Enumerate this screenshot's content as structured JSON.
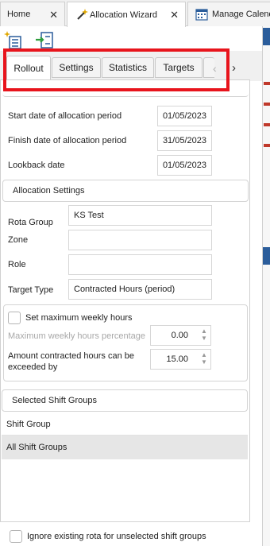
{
  "doc_tabs": {
    "home": "Home",
    "wizard": "Allocation Wizard",
    "manage": "Manage Calenda"
  },
  "inner_tabs": {
    "rollout": "Rollout",
    "settings": "Settings",
    "statistics": "Statistics",
    "targets": "Targets"
  },
  "dates": {
    "start_label": "Start date of allocation period",
    "start_value": "01/05/2023",
    "finish_label": "Finish date of allocation period",
    "finish_value": "31/05/2023",
    "lookback_label": "Lookback date",
    "lookback_value": "01/05/2023"
  },
  "allocation_settings": {
    "header": "Allocation Settings",
    "rota_group_label": "Rota Group",
    "rota_group_value": "KS Test",
    "zone_label": "Zone",
    "zone_value": "",
    "role_label": "Role",
    "role_value": "",
    "target_type_label": "Target Type",
    "target_type_value": "Contracted Hours (period)"
  },
  "weekly": {
    "set_max_label": "Set maximum weekly hours",
    "max_pct_label": "Maximum weekly hours percentage",
    "max_pct_value": "0.00",
    "exceed_label_1": "Amount contracted hours can be",
    "exceed_label_2": "exceeded by",
    "exceed_value": "15.00"
  },
  "shift_groups": {
    "header": "Selected Shift Groups",
    "column": "Shift Group",
    "items": [
      "All Shift Groups"
    ]
  },
  "footer": {
    "ignore_label": "Ignore existing rota for unselected shift groups"
  },
  "colors": {
    "highlight": "#e8141c",
    "accent_blue": "#2b5d9b"
  }
}
